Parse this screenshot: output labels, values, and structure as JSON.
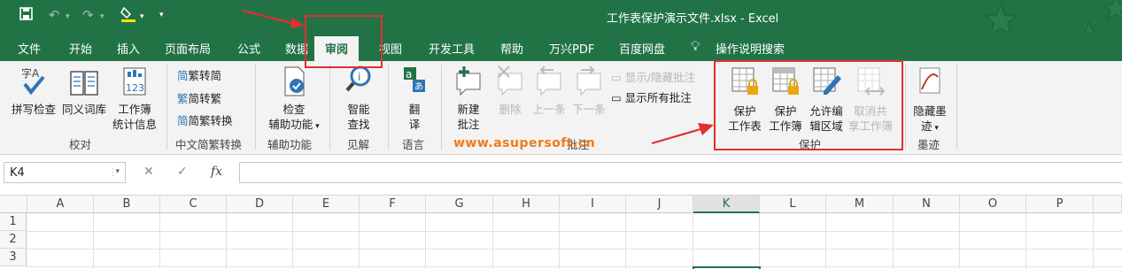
{
  "window": {
    "title": "工作表保护演示文件.xlsx  -  Excel"
  },
  "menu": {
    "tabs": [
      "文件",
      "开始",
      "插入",
      "页面布局",
      "公式",
      "数据",
      "审阅",
      "视图",
      "开发工具",
      "帮助",
      "万兴PDF",
      "百度网盘",
      "操作说明搜索"
    ],
    "active": "审阅"
  },
  "ribbon": {
    "proofing": {
      "spell": "拼写检查",
      "thesaurus": "同义词库",
      "stats_1": "工作簿",
      "stats_2": "统计信息",
      "group": "校对"
    },
    "chinese": {
      "to_trad": "繁转简",
      "to_simp": "简转繁",
      "convert": "简繁转换",
      "group": "中文简繁转换"
    },
    "accessibility": {
      "check_1": "检查",
      "check_2": "辅助功能",
      "group": "辅助功能"
    },
    "insights": {
      "smart_1": "智能",
      "smart_2": "查找",
      "group": "见解"
    },
    "language": {
      "translate_1": "翻",
      "translate_2": "译",
      "group": "语言"
    },
    "comments": {
      "new_1": "新建",
      "new_2": "批注",
      "delete": "删除",
      "prev": "上一条",
      "next": "下一条",
      "show_hide": "显示/隐藏批注",
      "show_all": "显示所有批注",
      "group": "批注"
    },
    "protect": {
      "sheet_1": "保护",
      "sheet_2": "工作表",
      "book_1": "保护",
      "book_2": "工作簿",
      "allow_1": "允许编",
      "allow_2": "辑区域",
      "unshare_1": "取消共",
      "unshare_2": "享工作簿",
      "group": "保护"
    },
    "ink": {
      "hide_1": "隐藏墨",
      "hide_2": "迹",
      "group": "墨迹"
    }
  },
  "watermark": "www.asupersoft.cn",
  "formula_bar": {
    "name_box": "K4",
    "cancel": "✕",
    "enter": "✓",
    "fx": "fx",
    "value": ""
  },
  "sheet": {
    "columns": [
      "A",
      "B",
      "C",
      "D",
      "E",
      "F",
      "G",
      "H",
      "I",
      "J",
      "K",
      "L",
      "M",
      "N",
      "O",
      "P"
    ],
    "selected_column": "K",
    "rows": [
      "1",
      "2",
      "3"
    ]
  },
  "colors": {
    "excel_green": "#217346",
    "highlight_red": "#e03030"
  }
}
